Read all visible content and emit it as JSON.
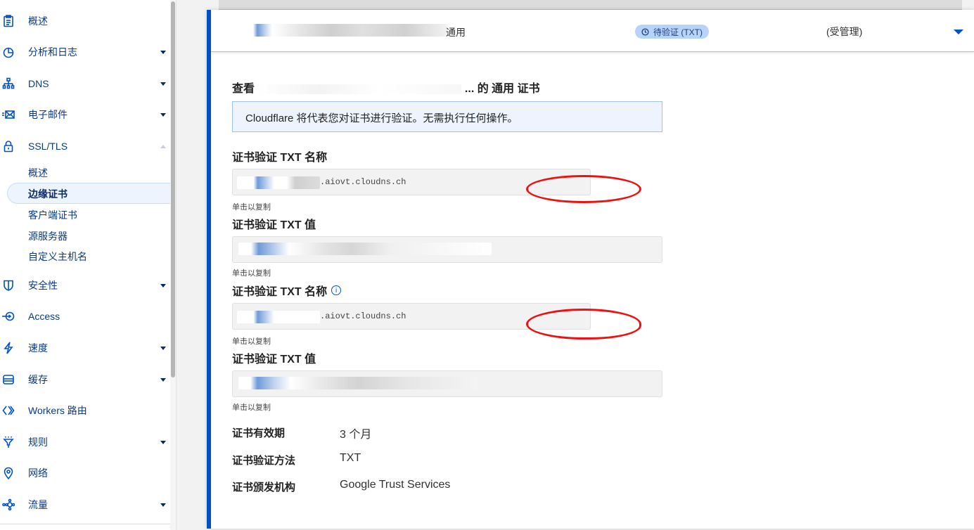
{
  "sidebar": {
    "items": [
      {
        "label": "概述",
        "icon": "clipboard-icon",
        "caret": "none"
      },
      {
        "label": "分析和日志",
        "icon": "pie-chart-icon",
        "caret": "down"
      },
      {
        "label": "DNS",
        "icon": "network-hierarchy-icon",
        "caret": "down"
      },
      {
        "label": "电子邮件",
        "icon": "email-icon",
        "caret": "down"
      },
      {
        "label": "SSL/TLS",
        "icon": "lock-icon",
        "caret": "up"
      },
      {
        "label": "安全性",
        "icon": "shield-icon",
        "caret": "down"
      },
      {
        "label": "Access",
        "icon": "access-icon",
        "caret": "none"
      },
      {
        "label": "速度",
        "icon": "lightning-icon",
        "caret": "down"
      },
      {
        "label": "缓存",
        "icon": "storage-icon",
        "caret": "down"
      },
      {
        "label": "Workers 路由",
        "icon": "workers-icon",
        "caret": "none"
      },
      {
        "label": "规则",
        "icon": "funnel-icon",
        "caret": "down"
      },
      {
        "label": "网络",
        "icon": "location-pin-icon",
        "caret": "none"
      },
      {
        "label": "流量",
        "icon": "traffic-icon",
        "caret": "down"
      }
    ],
    "ssl_subitems": [
      {
        "label": "概述",
        "active": false
      },
      {
        "label": "边缘证书",
        "active": true
      },
      {
        "label": "客户端证书",
        "active": false
      },
      {
        "label": "源服务器",
        "active": false
      },
      {
        "label": "自定义主机名",
        "active": false
      }
    ]
  },
  "certificate_row": {
    "type": "通用",
    "status": "待验证 (TXT)",
    "status_icon": "clock-icon",
    "managed": "(受管理)"
  },
  "details": {
    "title_prefix": "查看",
    "title_suffix": "... 的 通用 证书",
    "info_message": "Cloudflare 将代表您对证书进行验证。无需执行任何操作。",
    "fields": [
      {
        "label": "证书验证 TXT 名称",
        "value": ".aiovt.cloudns.ch",
        "hint": "单击以复制",
        "info_icon": false
      },
      {
        "label": "证书验证 TXT 值",
        "value": "",
        "hint": "单击以复制",
        "info_icon": false
      },
      {
        "label": "证书验证 TXT 名称",
        "value": ".aiovt.cloudns.ch",
        "hint": "单击以复制",
        "info_icon": true
      },
      {
        "label": "证书验证 TXT 值",
        "value": "",
        "hint": "单击以复制",
        "info_icon": false
      }
    ],
    "meta": [
      {
        "label": "证书有效期",
        "value": "3 个月"
      },
      {
        "label": "证书验证方法",
        "value": "TXT"
      },
      {
        "label": "证书颁发机构",
        "value": "Google Trust Services"
      }
    ],
    "info_icon_glyph": "i"
  },
  "colors": {
    "accent": "#0051c3",
    "badge_bg": "#b7d3fa",
    "annotation": "#ee1111"
  }
}
